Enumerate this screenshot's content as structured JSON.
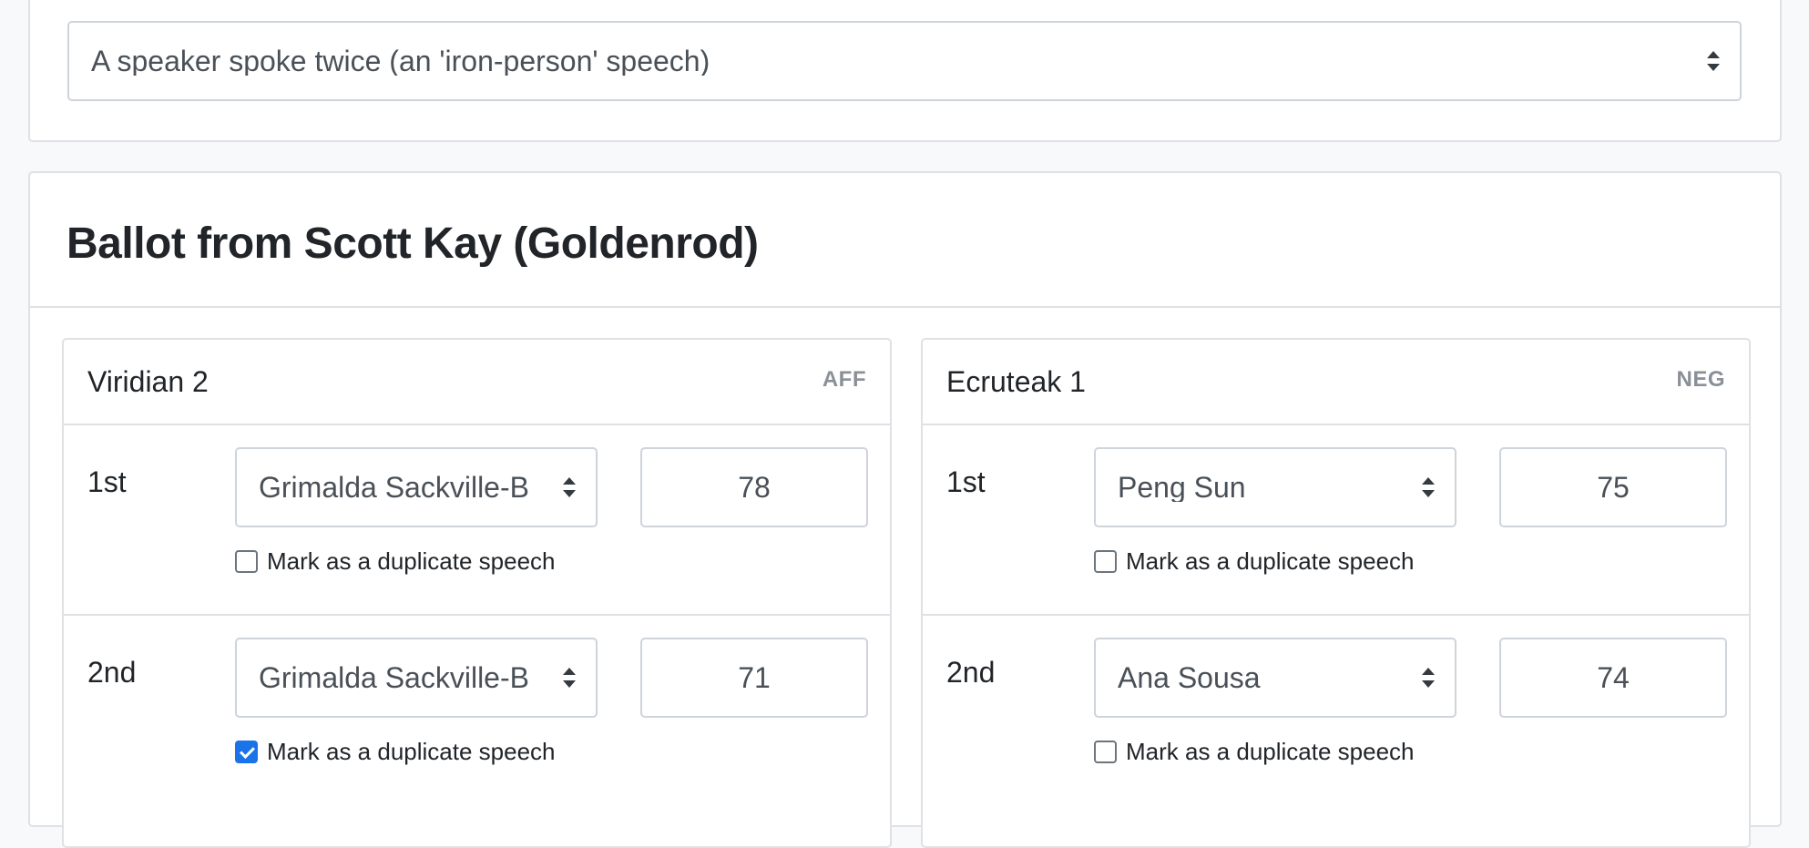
{
  "motion": {
    "selected": "A speaker spoke twice (an 'iron-person' speech)"
  },
  "ballot": {
    "title": "Ballot from Scott Kay (Goldenrod)",
    "dup_label": "Mark as a duplicate speech",
    "teams": [
      {
        "name": "Viridian 2",
        "side": "AFF",
        "speakers": [
          {
            "position": "1st",
            "speaker": "Grimalda Sackville-B",
            "score": "78",
            "duplicate": false
          },
          {
            "position": "2nd",
            "speaker": "Grimalda Sackville-B",
            "score": "71",
            "duplicate": true
          }
        ]
      },
      {
        "name": "Ecruteak 1",
        "side": "NEG",
        "speakers": [
          {
            "position": "1st",
            "speaker": "Peng Sun",
            "score": "75",
            "duplicate": false
          },
          {
            "position": "2nd",
            "speaker": "Ana Sousa",
            "score": "74",
            "duplicate": false
          }
        ]
      }
    ]
  },
  "colors": {
    "accent": "#1a73e8",
    "border": "#dfe1e4",
    "muted": "#8a9097"
  }
}
